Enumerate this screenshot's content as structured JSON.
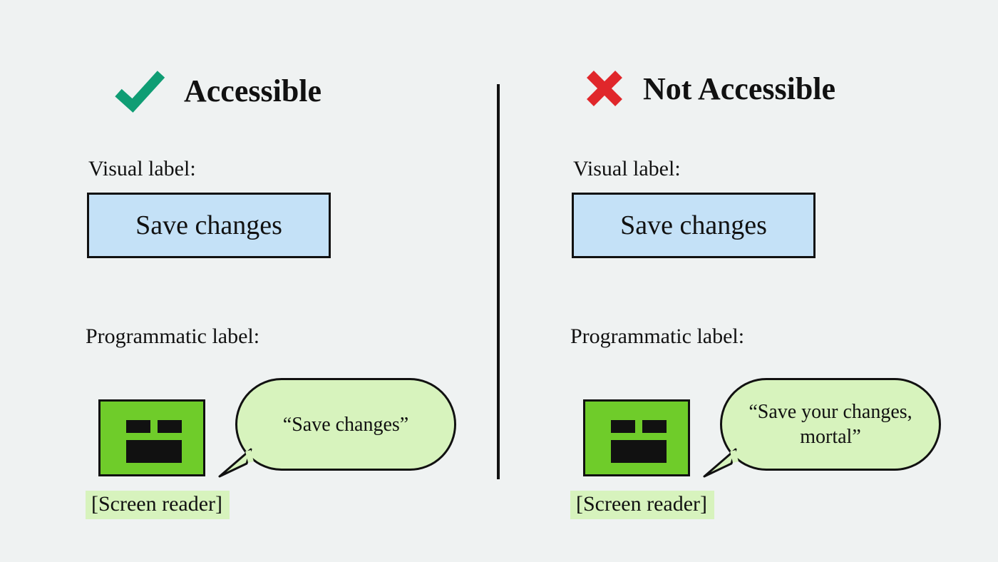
{
  "left": {
    "heading": "Accessible",
    "visual_label_caption": "Visual label:",
    "button_text": "Save changes",
    "programmatic_label_caption": "Programmatic label:",
    "speech": "“Save changes”",
    "screen_reader_tag": "[Screen reader]"
  },
  "right": {
    "heading": "Not Accessible",
    "visual_label_caption": "Visual label:",
    "button_text": "Save changes",
    "programmatic_label_caption": "Programmatic label:",
    "speech": "“Save your changes, mortal”",
    "screen_reader_tag": "[Screen reader]"
  },
  "colors": {
    "check": "#0f9d74",
    "cross": "#e0272b",
    "button_bg": "#c4e1f7",
    "bot_bg": "#6fcc2a",
    "bubble_bg": "#d7f3bd"
  }
}
